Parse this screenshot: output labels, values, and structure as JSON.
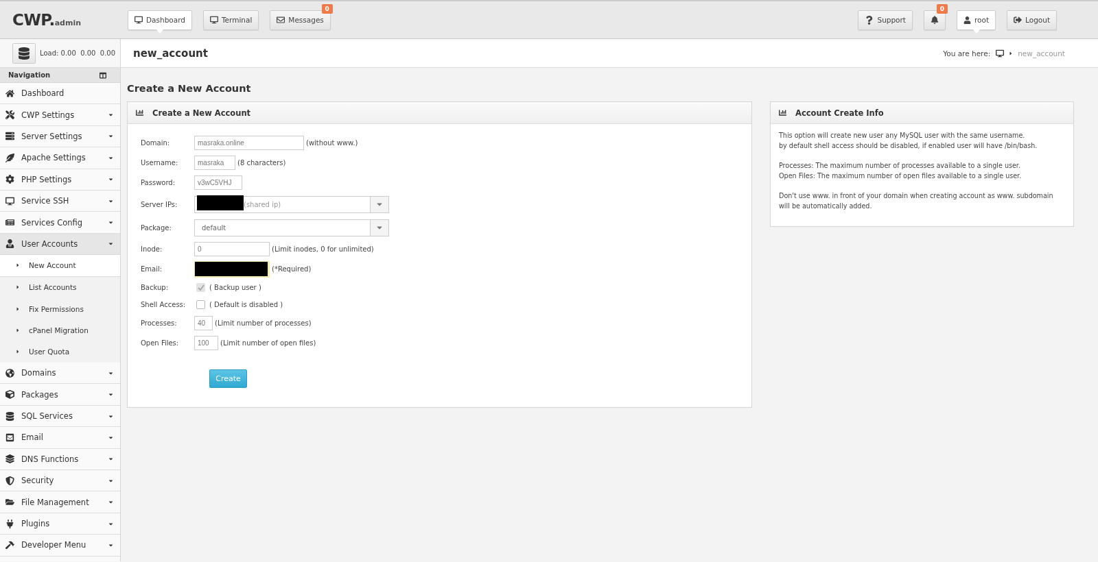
{
  "header": {
    "logo": {
      "main": "CWP.",
      "sub": "admin"
    },
    "nav_buttons": [
      {
        "label": "Dashboard",
        "selected": true
      },
      {
        "label": "Terminal",
        "selected": false
      },
      {
        "label": "Messages",
        "selected": false,
        "badge": "0"
      }
    ],
    "right_buttons": [
      {
        "label": "Support",
        "selected": false
      },
      {
        "selected": false,
        "badge": "0"
      },
      {
        "label": "root",
        "selected": true
      },
      {
        "label": "Logout",
        "selected": false
      }
    ]
  },
  "load": "Load: 0.00  0.00  0.00",
  "sidebar": {
    "title": "Navigation",
    "items": [
      {
        "label": "Dashboard",
        "kind": "link"
      },
      {
        "label": "CWP Settings",
        "kind": "menu"
      },
      {
        "label": "Server Settings",
        "kind": "menu"
      },
      {
        "label": "Apache Settings",
        "kind": "menu"
      },
      {
        "label": "PHP Settings",
        "kind": "menu"
      },
      {
        "label": "Service SSH",
        "kind": "menu"
      },
      {
        "label": "Services Config",
        "kind": "menu"
      },
      {
        "label": "User Accounts",
        "kind": "menu",
        "expanded": true,
        "children": [
          {
            "label": "New Account",
            "selected": true
          },
          {
            "label": "List Accounts",
            "selected": false
          },
          {
            "label": "Fix Permissions",
            "selected": false
          },
          {
            "label": "cPanel Migration",
            "selected": false
          },
          {
            "label": "User Quota",
            "selected": false
          }
        ]
      },
      {
        "label": "Domains",
        "kind": "menu"
      },
      {
        "label": "Packages",
        "kind": "menu"
      },
      {
        "label": "SQL Services",
        "kind": "menu"
      },
      {
        "label": "Email",
        "kind": "menu"
      },
      {
        "label": "DNS Functions",
        "kind": "menu"
      },
      {
        "label": "Security",
        "kind": "menu"
      },
      {
        "label": "File Management",
        "kind": "menu"
      },
      {
        "label": "Plugins",
        "kind": "menu"
      },
      {
        "label": "Developer Menu",
        "kind": "menu"
      }
    ]
  },
  "page": {
    "title": "new_account",
    "breadcrumb_label": "You are here:",
    "breadcrumb_current": "new_account",
    "heading": "Create a New Account"
  },
  "form_panel": {
    "title": "Create a New Account",
    "fields": [
      {
        "kind": "text",
        "label": "Domain:",
        "value": "masraka.online",
        "hint": "(without www.)"
      },
      {
        "kind": "text",
        "label": "Username:",
        "value": "masraka",
        "hint": "(8 characters)"
      },
      {
        "kind": "text",
        "label": "Password:",
        "value": "v3wC5VHJ"
      },
      {
        "kind": "select",
        "label": "Server IPs:",
        "redacted": true,
        "value": "(shared ip)"
      },
      {
        "kind": "select",
        "label": "Package:",
        "redacted": false,
        "value": "default"
      },
      {
        "kind": "text",
        "label": "Inode:",
        "value": "0",
        "hint": "(Limit inodes, 0 for unlimited)"
      },
      {
        "kind": "redacted",
        "label": "Email:",
        "hint": "(*Required)"
      },
      {
        "kind": "checkbox",
        "label": "Backup:",
        "checked": true,
        "disabled": true,
        "hint": "( Backup user )"
      },
      {
        "kind": "checkbox",
        "label": "Shell Access:",
        "checked": false,
        "disabled": false,
        "hint": "( Default is disabled )"
      },
      {
        "kind": "text",
        "label": "Processes:",
        "value": "40",
        "hint": "(Limit number of processes)"
      },
      {
        "kind": "text",
        "label": "Open Files:",
        "value": "100",
        "hint": "(Limit number of open files)"
      }
    ],
    "submit": "Create"
  },
  "info_panel": {
    "title": "Account Create Info",
    "paragraphs": [
      [
        "This option will create new user any MySQL user with the same username.",
        "by default shell access should be disabled, if enabled user will have /bin/bash."
      ],
      [
        "Processes: The maximum number of processes available to a single user.",
        "Open Files: The maximum number of open files available to a single user."
      ],
      [
        "Don't use www. in front of your domain when creating account as www. subdomain",
        "will be automatically added."
      ]
    ]
  }
}
